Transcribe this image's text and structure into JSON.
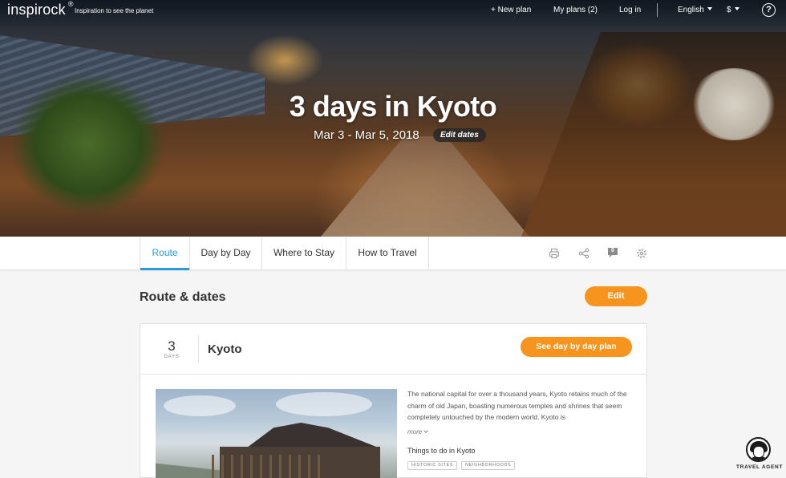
{
  "nav": {
    "logo": "inspirock",
    "logo_mark": "®",
    "tagline": "Inspiration to see the planet",
    "new_plan": "+ New plan",
    "my_plans": "My plans (2)",
    "login": "Log in",
    "language": "English",
    "currency": "$",
    "help": "?"
  },
  "hero": {
    "title": "3 days in Kyoto",
    "dates": "Mar 3  -  Mar 5, 2018",
    "edit_dates": "Edit dates"
  },
  "tabs": [
    {
      "label": "Route",
      "active": true
    },
    {
      "label": "Day by Day",
      "active": false
    },
    {
      "label": "Where to Stay",
      "active": false
    },
    {
      "label": "How to Travel",
      "active": false
    }
  ],
  "tools": {
    "print_icon": "printer-icon",
    "share_icon": "share-icon",
    "comments_icon": "comment-icon",
    "comments_count": "0",
    "settings_icon": "gear-icon"
  },
  "main": {
    "section_title": "Route & dates",
    "edit_label": "Edit"
  },
  "destination": {
    "days": "3",
    "days_label": "DAYS",
    "city": "Kyoto",
    "cta": "See day by day plan",
    "description": "The national capital for over a thousand years, Kyoto retains much of the charm of old Japan, boasting numerous temples and shrines that seem completely untouched by the modern world. Kyoto is",
    "more": "more",
    "things_title": "Things to do in Kyoto",
    "tags": [
      "HISTORIC SITES",
      "NEIGHBORHOODS"
    ]
  },
  "agent": {
    "label": "TRAVEL AGENT"
  },
  "colors": {
    "accent_orange": "#f7941d",
    "tab_active_blue": "#2a9bd8"
  }
}
